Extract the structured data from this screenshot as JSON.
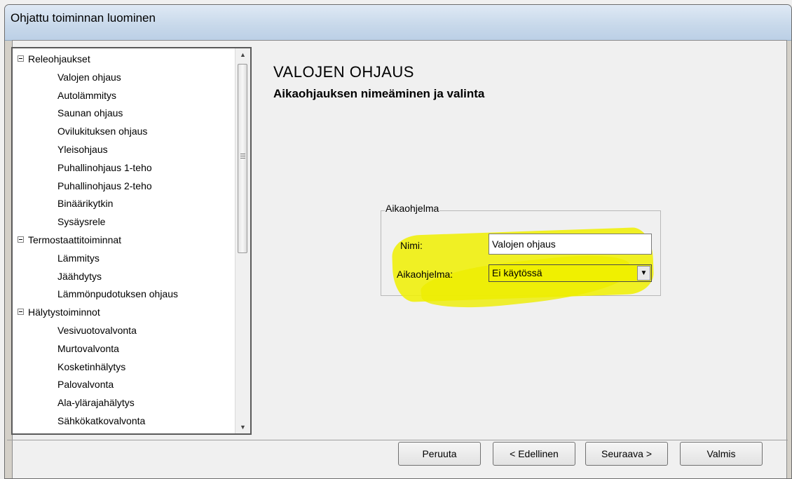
{
  "window": {
    "title": "Ohjattu toiminnan luominen"
  },
  "tree": {
    "groups": [
      {
        "label": "Releohjaukset",
        "items": [
          "Valojen ohjaus",
          "Autolämmitys",
          "Saunan ohjaus",
          "Ovilukituksen ohjaus",
          "Yleisohjaus",
          "Puhallinohjaus 1-teho",
          "Puhallinohjaus 2-teho",
          "Binäärikytkin",
          "Sysäysrele"
        ]
      },
      {
        "label": "Termostaattitoiminnat",
        "items": [
          "Lämmitys",
          "Jäähdytys",
          "Lämmönpudotuksen ohjaus"
        ]
      },
      {
        "label": "Hälytystoiminnot",
        "items": [
          "Vesivuotovalvonta",
          "Murtovalvonta",
          "Kosketinhälytys",
          "Palovalvonta",
          "Ala-ylärajahälytys",
          "Sähkökatkovalvonta"
        ]
      }
    ]
  },
  "content": {
    "heading": "VALOJEN OHJAUS",
    "subheading": "Aikaohjauksen nimeäminen ja valinta",
    "group_label": "Aikaohjelma",
    "name_label": "Nimi:",
    "name_value": "Valojen ohjaus",
    "program_label": "Aikaohjelma:",
    "program_value": "Ei käytössä",
    "highlight_color": "#f0f000"
  },
  "buttons": {
    "cancel": "Peruuta",
    "previous": "< Edellinen",
    "next": "Seuraava >",
    "finish": "Valmis"
  }
}
